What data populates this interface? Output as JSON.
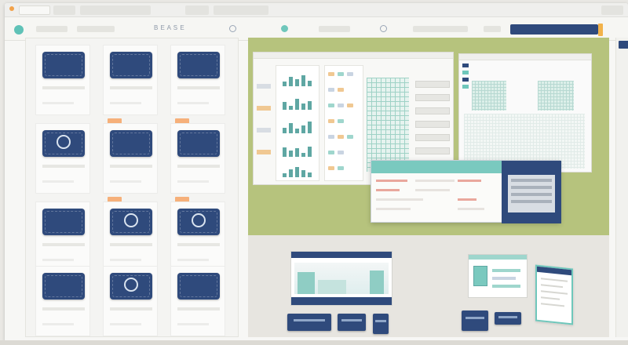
{
  "window": {
    "toolbar_label": "B E A S E",
    "action_button": ""
  },
  "grid": {
    "cards": [
      {
        "meta": "  ",
        "variant": "plain"
      },
      {
        "meta": "  ",
        "variant": "plain"
      },
      {
        "meta": "  ",
        "variant": "plain"
      },
      {
        "meta": "  ",
        "variant": "ring"
      },
      {
        "meta": "  ",
        "variant": "plain"
      },
      {
        "meta": "  ",
        "variant": "plain"
      },
      {
        "meta": "  ",
        "variant": "plain"
      },
      {
        "meta": "  ",
        "variant": "ring"
      },
      {
        "meta": "  ",
        "variant": "ring"
      },
      {
        "meta": "  ",
        "variant": "plain"
      },
      {
        "meta": "  ",
        "variant": "ring"
      },
      {
        "meta": "  ",
        "variant": "plain"
      }
    ]
  },
  "dialog": {
    "title": ""
  },
  "colors": {
    "navy": "#2f4a7c",
    "teal": "#6fc7bb",
    "olive": "#b6c37d",
    "orange": "#f2a24a"
  },
  "icons": [
    "tab-dot-icon",
    "app-logo-icon",
    "settings-icon",
    "share-icon",
    "profile-icon"
  ]
}
